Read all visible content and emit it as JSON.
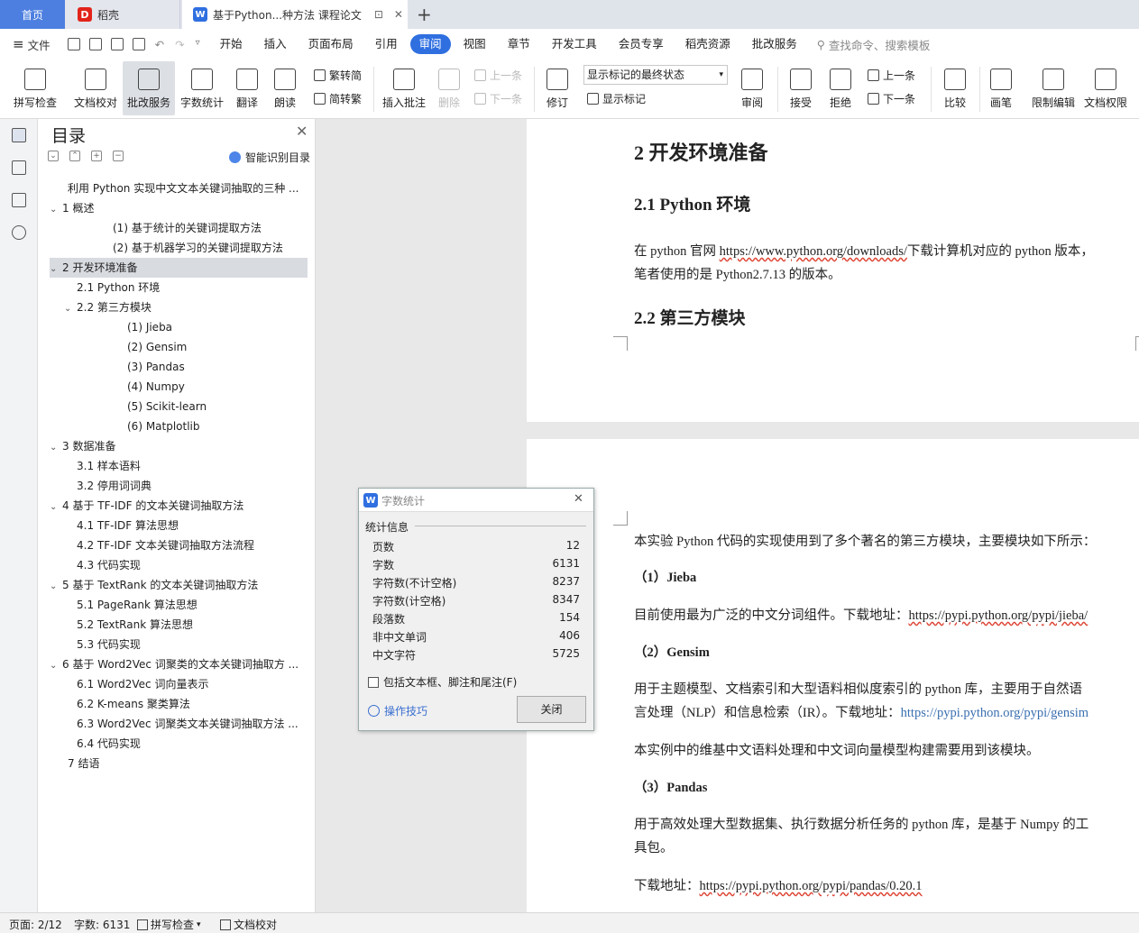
{
  "tabs": {
    "home": "首页",
    "daoke": "稻壳",
    "doc": "基于Python...种方法 课程论文",
    "add": "+"
  },
  "menubar": {
    "file": "文件",
    "items": [
      "开始",
      "插入",
      "页面布局",
      "引用",
      "审阅",
      "视图",
      "章节",
      "开发工具",
      "会员专享",
      "稻壳资源",
      "批改服务"
    ],
    "active": "审阅",
    "search": "查找命令、搜索模板"
  },
  "ribbon": {
    "spell": "拼写检查",
    "proof": "文档校对",
    "review_service": "批改服务",
    "word_count": "字数统计",
    "translate": "翻译",
    "read_aloud": "朗读",
    "trad": "繁转简",
    "simp": "简转繁",
    "insert_comment": "插入批注",
    "delete": "删除",
    "prev_c": "上一条",
    "next_c": "下一条",
    "revise": "修订",
    "mark_state": "显示标记的最终状态",
    "show_mark": "显示标记",
    "review": "审阅",
    "accept": "接受",
    "reject": "拒绝",
    "prev": "上一条",
    "next": "下一条",
    "compare": "比较",
    "pen": "画笔",
    "restrict": "限制编辑",
    "perm": "文档权限"
  },
  "toc": {
    "title": "目录",
    "smart": "智能识别目录",
    "items": [
      {
        "text": "利用 Python 实现中文文本关键词抽取的三种 ...",
        "indent": 0,
        "caret": ""
      },
      {
        "text": "1  概述",
        "indent": 0,
        "caret": "v"
      },
      {
        "text": "(1)  基于统计的关键词提取方法",
        "indent": 3,
        "caret": ""
      },
      {
        "text": "(2)  基于机器学习的关键词提取方法",
        "indent": 3,
        "caret": ""
      },
      {
        "text": "2  开发环境准备",
        "indent": 0,
        "caret": "v"
      },
      {
        "text": "2.1 Python 环境",
        "indent": 1,
        "caret": ""
      },
      {
        "text": "2.2  第三方模块",
        "indent": 1,
        "caret": "v"
      },
      {
        "text": "(1)  Jieba",
        "indent": 4,
        "caret": ""
      },
      {
        "text": "(2)  Gensim",
        "indent": 4,
        "caret": ""
      },
      {
        "text": "(3)  Pandas",
        "indent": 4,
        "caret": ""
      },
      {
        "text": "(4)  Numpy",
        "indent": 4,
        "caret": ""
      },
      {
        "text": "(5)  Scikit-learn",
        "indent": 4,
        "caret": ""
      },
      {
        "text": "(6)  Matplotlib",
        "indent": 4,
        "caret": ""
      },
      {
        "text": "3  数据准备",
        "indent": 0,
        "caret": "v"
      },
      {
        "text": "3.1  样本语料",
        "indent": 1,
        "caret": ""
      },
      {
        "text": "3.2  停用词词典",
        "indent": 1,
        "caret": ""
      },
      {
        "text": "4  基于 TF-IDF 的文本关键词抽取方法",
        "indent": 0,
        "caret": "v"
      },
      {
        "text": "4.1 TF-IDF 算法思想",
        "indent": 1,
        "caret": ""
      },
      {
        "text": "4.2 TF-IDF 文本关键词抽取方法流程",
        "indent": 1,
        "caret": ""
      },
      {
        "text": "4.3  代码实现",
        "indent": 1,
        "caret": ""
      },
      {
        "text": "5  基于 TextRank 的文本关键词抽取方法",
        "indent": 0,
        "caret": "v"
      },
      {
        "text": "5.1 PageRank 算法思想",
        "indent": 1,
        "caret": ""
      },
      {
        "text": "5.2 TextRank 算法思想",
        "indent": 1,
        "caret": ""
      },
      {
        "text": "5.3  代码实现",
        "indent": 1,
        "caret": ""
      },
      {
        "text": "6  基于 Word2Vec 词聚类的文本关键词抽取方 ...",
        "indent": 0,
        "caret": "v"
      },
      {
        "text": "6.1 Word2Vec 词向量表示",
        "indent": 1,
        "caret": ""
      },
      {
        "text": "6.2 K-means 聚类算法",
        "indent": 1,
        "caret": ""
      },
      {
        "text": "6.3 Word2Vec 词聚类文本关键词抽取方法 ...",
        "indent": 1,
        "caret": ""
      },
      {
        "text": "6.4  代码实现",
        "indent": 1,
        "caret": ""
      },
      {
        "text": "7  结语",
        "indent": 0,
        "caret": ""
      }
    ],
    "selected_index": 4
  },
  "doc": {
    "h_env": "2  开发环境准备",
    "h_py": "2.1 Python 环境",
    "p_py_1a": "在 python 官网 ",
    "p_py_link": "https://www.python.org/downloads/",
    "p_py_1b": "下载计算机对应的 python 版本，",
    "p_py_2": "笔者使用的是 Python2.7.13 的版本。",
    "h_third": "2.2  第三方模块",
    "p_intro": "本实验 Python 代码的实现使用到了多个著名的第三方模块，主要模块如下所示：",
    "h_jieba": "（1）Jieba",
    "p_jieba_a": "目前使用最为广泛的中文分词组件。下载地址：",
    "p_jieba_link": "https://pypi.python.org/pypi/jieba/",
    "h_gensim": "（2）Gensim",
    "p_gensim_1": "用于主题模型、文档索引和大型语料相似度索引的 python 库，主要用于自然语",
    "p_gensim_2a": "言处理（NLP）和信息检索（IR）。下载地址：",
    "p_gensim_link": "https://pypi.python.org/pypi/gensim",
    "p_gensim_3": "本实例中的维基中文语料处理和中文词向量模型构建需要用到该模块。",
    "h_pandas": "（3）Pandas",
    "p_pandas_1": "用于高效处理大型数据集、执行数据分析任务的 python 库，是基于 Numpy 的工",
    "p_pandas_2": "具包。",
    "p_pandas_3a": "下载地址：",
    "p_pandas_link": "https://pypi.python.org/pypi/pandas/0.20.1"
  },
  "dialog": {
    "title": "字数统计",
    "section": "统计信息",
    "rows": [
      {
        "label": "页数",
        "value": "12"
      },
      {
        "label": "字数",
        "value": "6131"
      },
      {
        "label": "字符数(不计空格)",
        "value": "8237"
      },
      {
        "label": "字符数(计空格)",
        "value": "8347"
      },
      {
        "label": "段落数",
        "value": "154"
      },
      {
        "label": "非中文单词",
        "value": "406"
      },
      {
        "label": "中文字符",
        "value": "5725"
      }
    ],
    "checkbox": "包括文本框、脚注和尾注(F)",
    "tips": "操作技巧",
    "close": "关闭"
  },
  "status": {
    "page": "页面: 2/12",
    "words": "字数: 6131",
    "spell": "拼写检查",
    "proof": "文档校对"
  },
  "colors": {
    "accent": "#2f6fe0",
    "home_tab": "#4d7fe0"
  }
}
